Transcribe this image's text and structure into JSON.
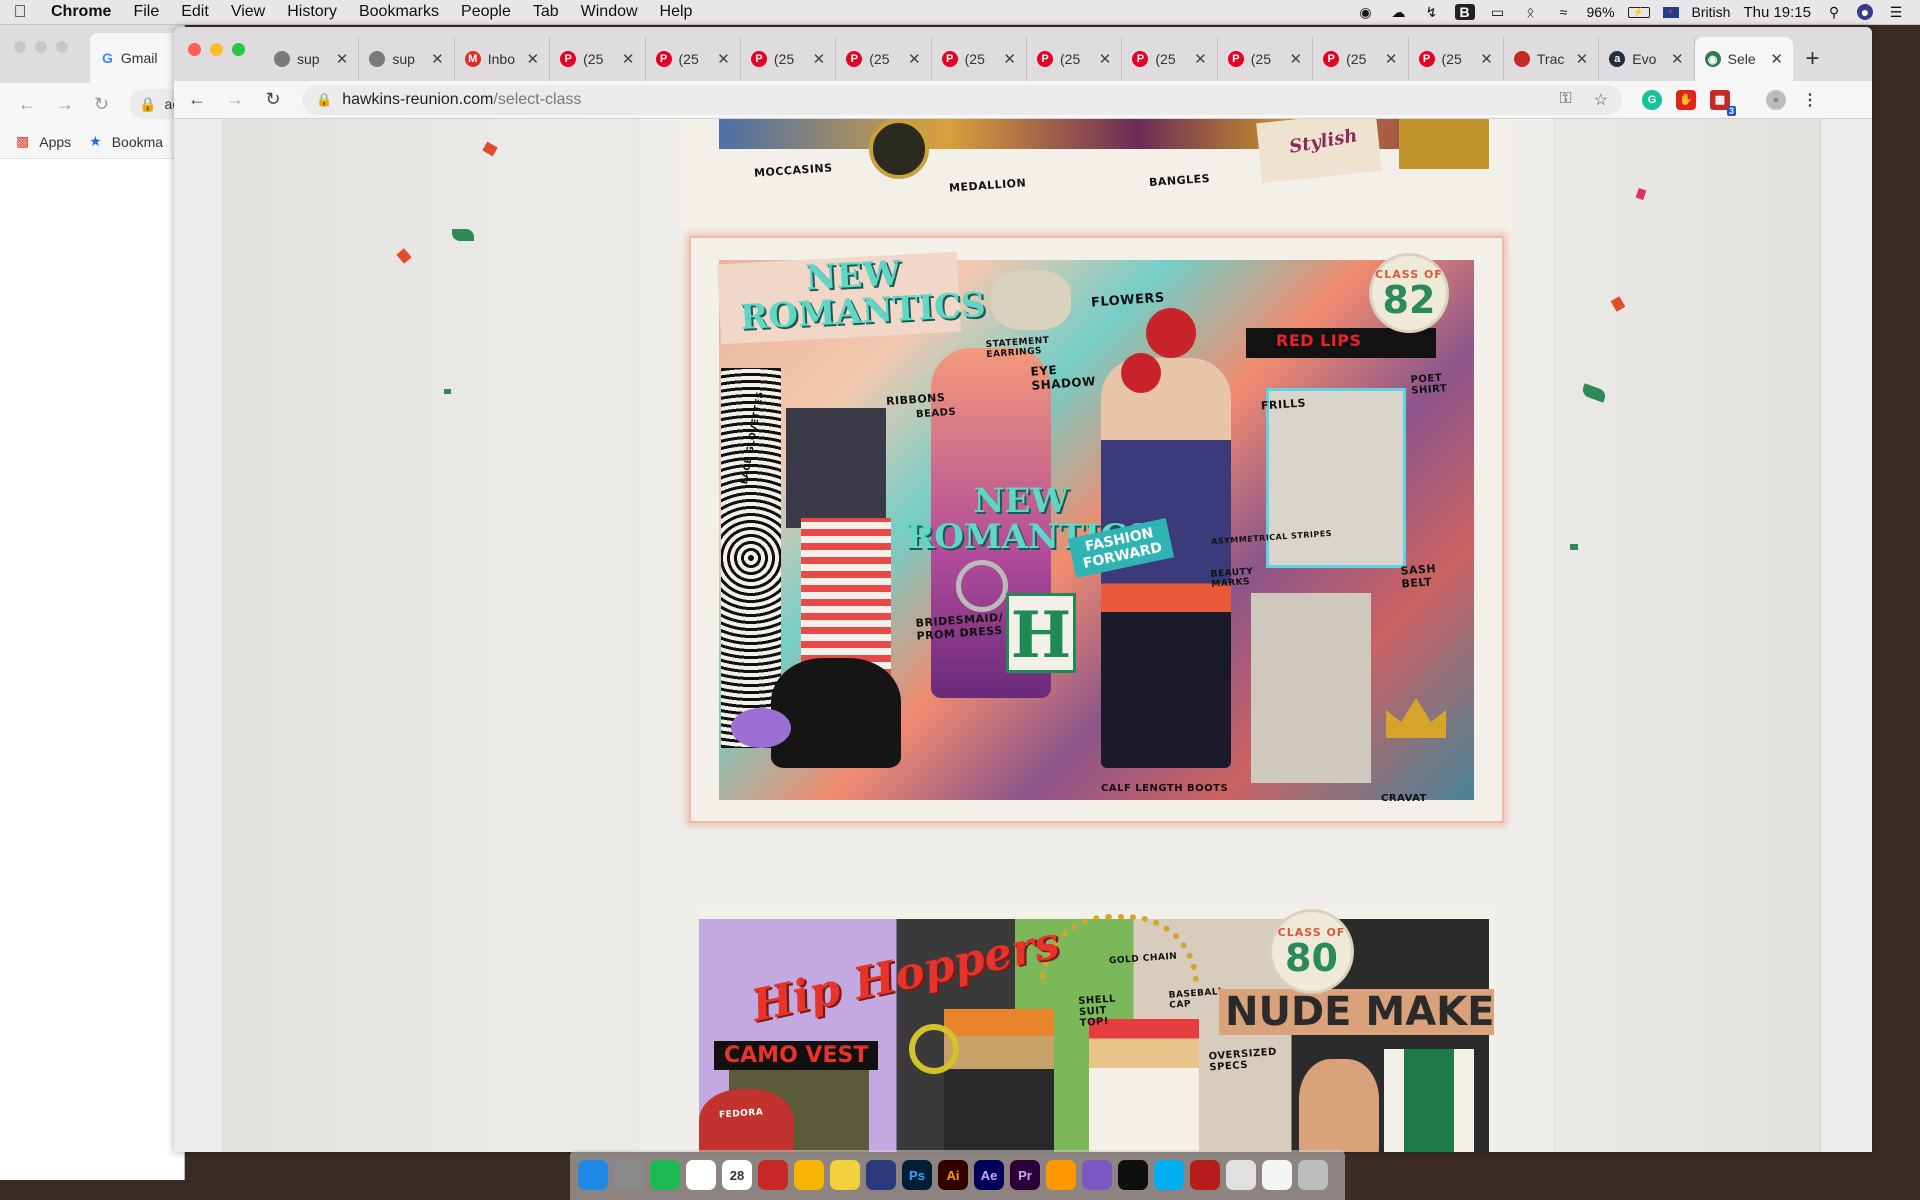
{
  "menubar": {
    "app": "Chrome",
    "items": [
      "File",
      "Edit",
      "View",
      "History",
      "Bookmarks",
      "People",
      "Tab",
      "Window",
      "Help"
    ],
    "battery": "96%",
    "input_source": "British",
    "clock": "Thu 19:15"
  },
  "background_window": {
    "tab_title": "Gmail",
    "address_partial": "ac",
    "bookmarks": [
      "Apps",
      "Bookma"
    ]
  },
  "tabs": [
    {
      "title": "sup",
      "icon": "globe-icon",
      "color": "#7a7a7a",
      "letter": ""
    },
    {
      "title": "sup",
      "icon": "globe-icon",
      "color": "#7a7a7a",
      "letter": ""
    },
    {
      "title": "Inbo",
      "icon": "gmail-icon",
      "color": "#d93025",
      "letter": "M"
    },
    {
      "title": "(25",
      "icon": "pinterest-icon",
      "color": "#e60023",
      "letter": "P"
    },
    {
      "title": "(25",
      "icon": "pinterest-icon",
      "color": "#e60023",
      "letter": "P"
    },
    {
      "title": "(25",
      "icon": "pinterest-icon",
      "color": "#e60023",
      "letter": "P"
    },
    {
      "title": "(25",
      "icon": "pinterest-icon",
      "color": "#e60023",
      "letter": "P"
    },
    {
      "title": "(25",
      "icon": "pinterest-icon",
      "color": "#e60023",
      "letter": "P"
    },
    {
      "title": "(25",
      "icon": "pinterest-icon",
      "color": "#e60023",
      "letter": "P"
    },
    {
      "title": "(25",
      "icon": "pinterest-icon",
      "color": "#e60023",
      "letter": "P"
    },
    {
      "title": "(25",
      "icon": "pinterest-icon",
      "color": "#e60023",
      "letter": "P"
    },
    {
      "title": "(25",
      "icon": "pinterest-icon",
      "color": "#e60023",
      "letter": "P"
    },
    {
      "title": "(25",
      "icon": "pinterest-icon",
      "color": "#e60023",
      "letter": "P"
    },
    {
      "title": "Trac",
      "icon": "trac-icon",
      "color": "#c62828",
      "letter": ""
    },
    {
      "title": "Evo",
      "icon": "amazon-icon",
      "color": "#232f3e",
      "letter": "a"
    }
  ],
  "active_tab": {
    "title": "Sele",
    "icon": "site-icon"
  },
  "address": {
    "host": "hawkins-reunion.com",
    "path": "/select-class"
  },
  "extension_badge": "3",
  "page": {
    "top_labels": [
      "MOCCASINS",
      "MEDALLION",
      "BANGLES",
      "Stylish"
    ],
    "featured": {
      "title_top": "NEW ROMANTICS",
      "title_mid": "NEW ROMANTICS",
      "badge_prefix": "CLASS OF",
      "badge_year": "82",
      "sticker": "FASHION FORWARD",
      "letter": "H",
      "labels": [
        "FLOWERS",
        "STATEMENT EARRINGS",
        "EYE SHADOW",
        "RED LIPS",
        "POET SHIRT",
        "FRILLS",
        "RIBBONS",
        "BEADS",
        "LACE GLOVETTES",
        "ASYMMETRICAL STRIPES",
        "BEAUTY MARKS",
        "SASH BELT",
        "BRIDESMAID/ PROM DRESS",
        "CALF LENGTH BOOTS",
        "CRAVAT"
      ]
    },
    "next": {
      "title": "Hip Hoppers",
      "badge_prefix": "CLASS OF",
      "badge_year": "80",
      "labels": [
        "CAMO VEST",
        "GOLD CHAIN",
        "BASEBALL CAP",
        "SHELL SUIT TOP!",
        "NUDE MAKEUP",
        "OVERSIZED SPECS",
        "FEDORA"
      ]
    }
  },
  "dock": [
    "finder-icon",
    "system-prefs-icon",
    "spotify-icon",
    "chrome-icon",
    "calendar-icon",
    "scrivener-icon",
    "sketch-icon",
    "stickies-icon",
    "cinema4d-icon",
    "photoshop-icon",
    "illustrator-icon",
    "aftereffects-icon",
    "premiere-icon",
    "sublime-icon",
    "pcloud-icon",
    "vscode-icon",
    "skype-icon",
    "acrobat-icon",
    "preview-icon",
    "documents-icon",
    "trash-icon"
  ],
  "dock_labels": {
    "calendar": "28",
    "photoshop": "Ps",
    "illustrator": "Ai",
    "aftereffects": "Ae",
    "premiere": "Pr"
  }
}
